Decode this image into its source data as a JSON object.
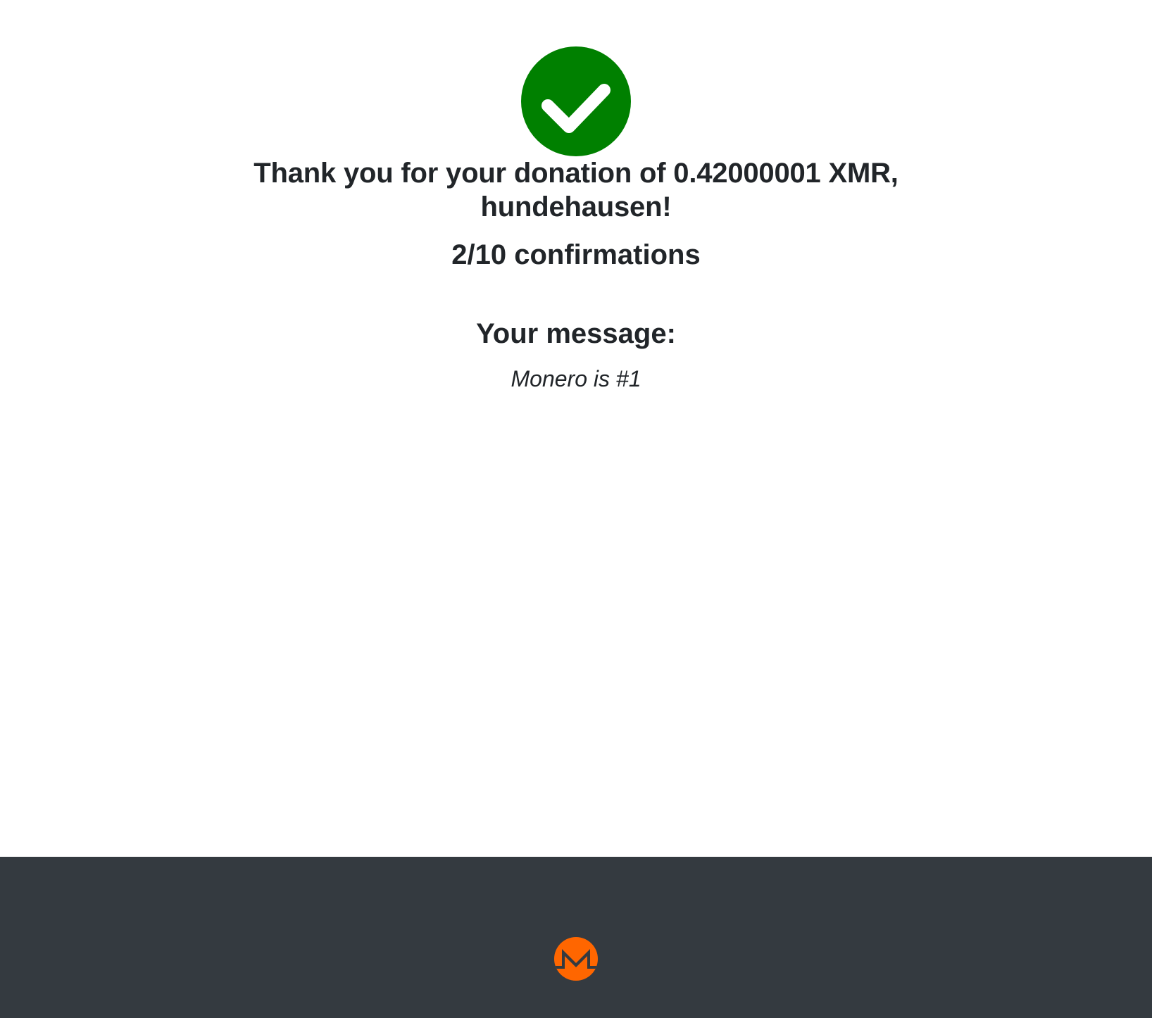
{
  "status": {
    "icon": "check-circle-icon",
    "color": "#008000"
  },
  "donation": {
    "thanks_line1": "Thank you for your donation of 0.42000001 XMR,",
    "thanks_line2": "hundehausen!",
    "confirmations": "2/10 confirmations"
  },
  "message": {
    "heading": "Your message:",
    "text": "Monero is #1"
  },
  "footer": {
    "logo_icon": "monero-logo-icon",
    "logo_color": "#ff6600",
    "background": "#343a40"
  }
}
